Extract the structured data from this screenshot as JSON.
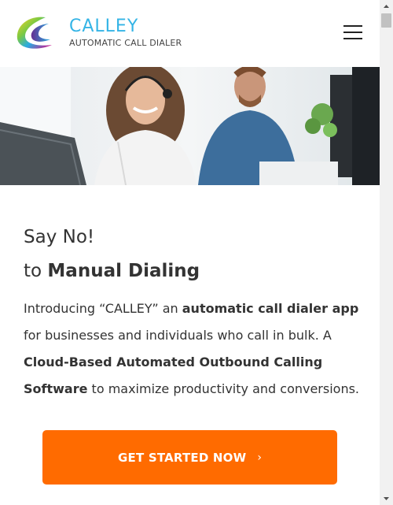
{
  "brand": {
    "name": "CALLEY",
    "tagline": "AUTOMATIC CALL DIALER"
  },
  "headline": {
    "line1": "Say No!",
    "line2_prefix": "to ",
    "line2_bold": "Manual Dialing"
  },
  "intro": {
    "p1": "Introducing “CALLEY” an ",
    "b1": "automatic call dialer app",
    "p2": " for businesses and individuals who call in bulk. A ",
    "b2": "Cloud-Based Automated Outbound Calling Software",
    "p3": " to maximize productivity and conversions."
  },
  "cta": {
    "label": "GET STARTED NOW",
    "arrow": "›"
  },
  "colors": {
    "brand_blue": "#34b4e6",
    "cta_orange": "#ff6b00",
    "text": "#333333"
  },
  "icons": {
    "menu": "hamburger-menu-icon",
    "logo": "calley-logo-icon"
  }
}
